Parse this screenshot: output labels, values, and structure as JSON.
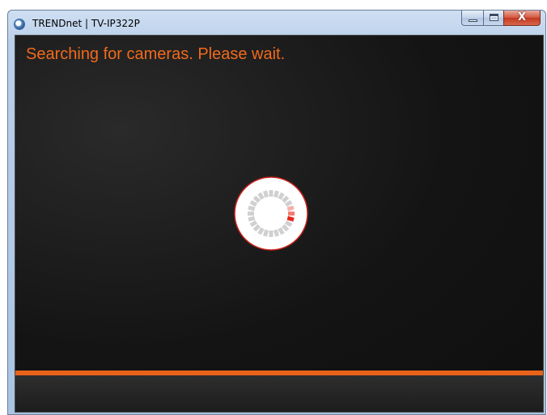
{
  "window": {
    "title": "TRENDnet | TV-IP322P",
    "app_icon": "trendnet-app-icon",
    "caption_buttons": {
      "minimize_icon": "minimize-icon",
      "maximize_icon": "maximize-icon",
      "close_glyph": "X"
    }
  },
  "main": {
    "status_message": "Searching for cameras. Please wait.",
    "spinner": {
      "icon": "loading-spinner-icon",
      "segments": 24,
      "active_segment_color": "#e8261a",
      "inactive_segment_color": "#d0d0d0"
    }
  },
  "colors": {
    "accent": "#e8621a",
    "status_text": "#f26a1b",
    "background": "#141414"
  }
}
